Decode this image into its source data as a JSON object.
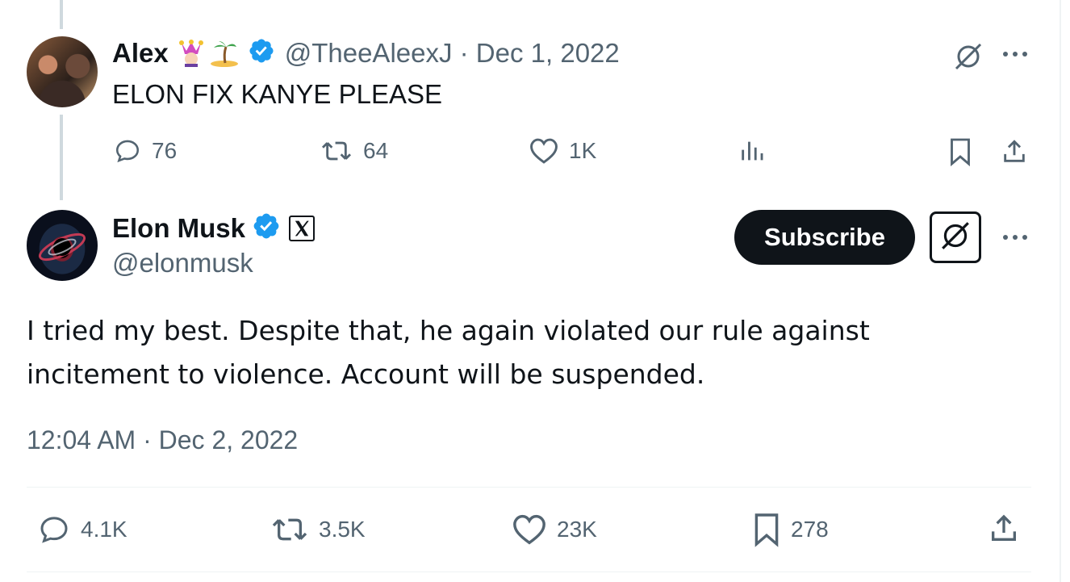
{
  "colors": {
    "accent": "#1d9bf0",
    "text": "#0f1419",
    "muted": "#536471",
    "line": "#cfd9de"
  },
  "reply_tweet": {
    "author_name": "Alex",
    "handle_date": "@TheeAleexJ · Dec 1, 2022",
    "text": "ELON FIX KANYE PLEASE",
    "stats": {
      "replies": "76",
      "reposts": "64",
      "likes": "1K"
    },
    "emojis": [
      "jester-emoji",
      "island-emoji"
    ]
  },
  "main_tweet": {
    "author_name": "Elon Musk",
    "handle": "@elonmusk",
    "subscribe_label": "Subscribe",
    "text_line1": "I tried my best. Despite that, he again violated our rule against",
    "text_line2": "incitement to violence. Account will be suspended.",
    "timestamp": "12:04 AM · Dec 2, 2022",
    "stats": {
      "replies": "4.1K",
      "reposts": "3.5K",
      "likes": "23K",
      "bookmarks": "278"
    }
  },
  "icons": {
    "reply": "reply-icon",
    "repost": "repost-icon",
    "like": "heart-icon",
    "views": "views-icon",
    "bookmark": "bookmark-icon",
    "share": "share-icon",
    "grok": "grok-icon",
    "more": "more-icon",
    "verified": "verified-badge-icon",
    "x_logo": "x-logo-icon"
  }
}
